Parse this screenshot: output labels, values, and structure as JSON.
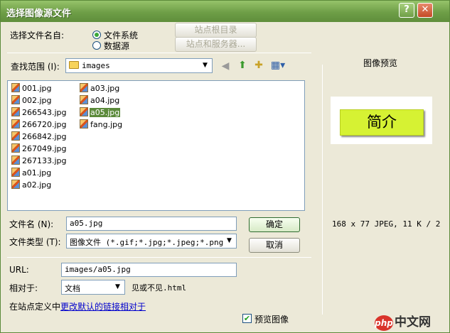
{
  "window": {
    "title": "选择图像源文件"
  },
  "select_from": {
    "label": "选择文件名自:",
    "option_filesystem": "文件系统",
    "option_datasource": "数据源",
    "selected": "文件系统"
  },
  "site_buttons": {
    "site_root": "站点根目录",
    "site_server": "站点和服务器..."
  },
  "lookin": {
    "label": "查找范围 (I):",
    "value": "images"
  },
  "files_col1": [
    "001.jpg",
    "002.jpg",
    "266543.jpg",
    "266720.jpg",
    "266842.jpg",
    "267049.jpg",
    "267133.jpg",
    "a01.jpg",
    "a02.jpg"
  ],
  "files_col2": [
    "a03.jpg",
    "a04.jpg",
    "a05.jpg",
    "fang.jpg"
  ],
  "selected_file": "a05.jpg",
  "filename": {
    "label": "文件名 (N):",
    "value": "a05.jpg"
  },
  "filetype": {
    "label": "文件类型 (T):",
    "value": "图像文件 (*.gif;*.jpg;*.jpeg;*.png;*"
  },
  "buttons": {
    "ok": "确定",
    "cancel": "取消"
  },
  "url": {
    "label": "URL:",
    "value": "images/a05.jpg"
  },
  "relative": {
    "label": "相对于:",
    "value": "文档",
    "hint": "见或不见.html"
  },
  "site_def": {
    "text": "在站点定义中",
    "link": "更改默认的链接相对于"
  },
  "preview": {
    "title": "图像预览",
    "image_text": "简介",
    "info": "168 x 77 JPEG, 11 K / 2",
    "checkbox_label": "预览图像",
    "checked": true
  },
  "watermark": {
    "badge": "php",
    "text": "中文网"
  },
  "colors": {
    "titlebar": "#6e9e47",
    "selection": "#5b8a3a",
    "preview_bg": "#d6f233",
    "dialog_bg": "#ece9d8"
  }
}
